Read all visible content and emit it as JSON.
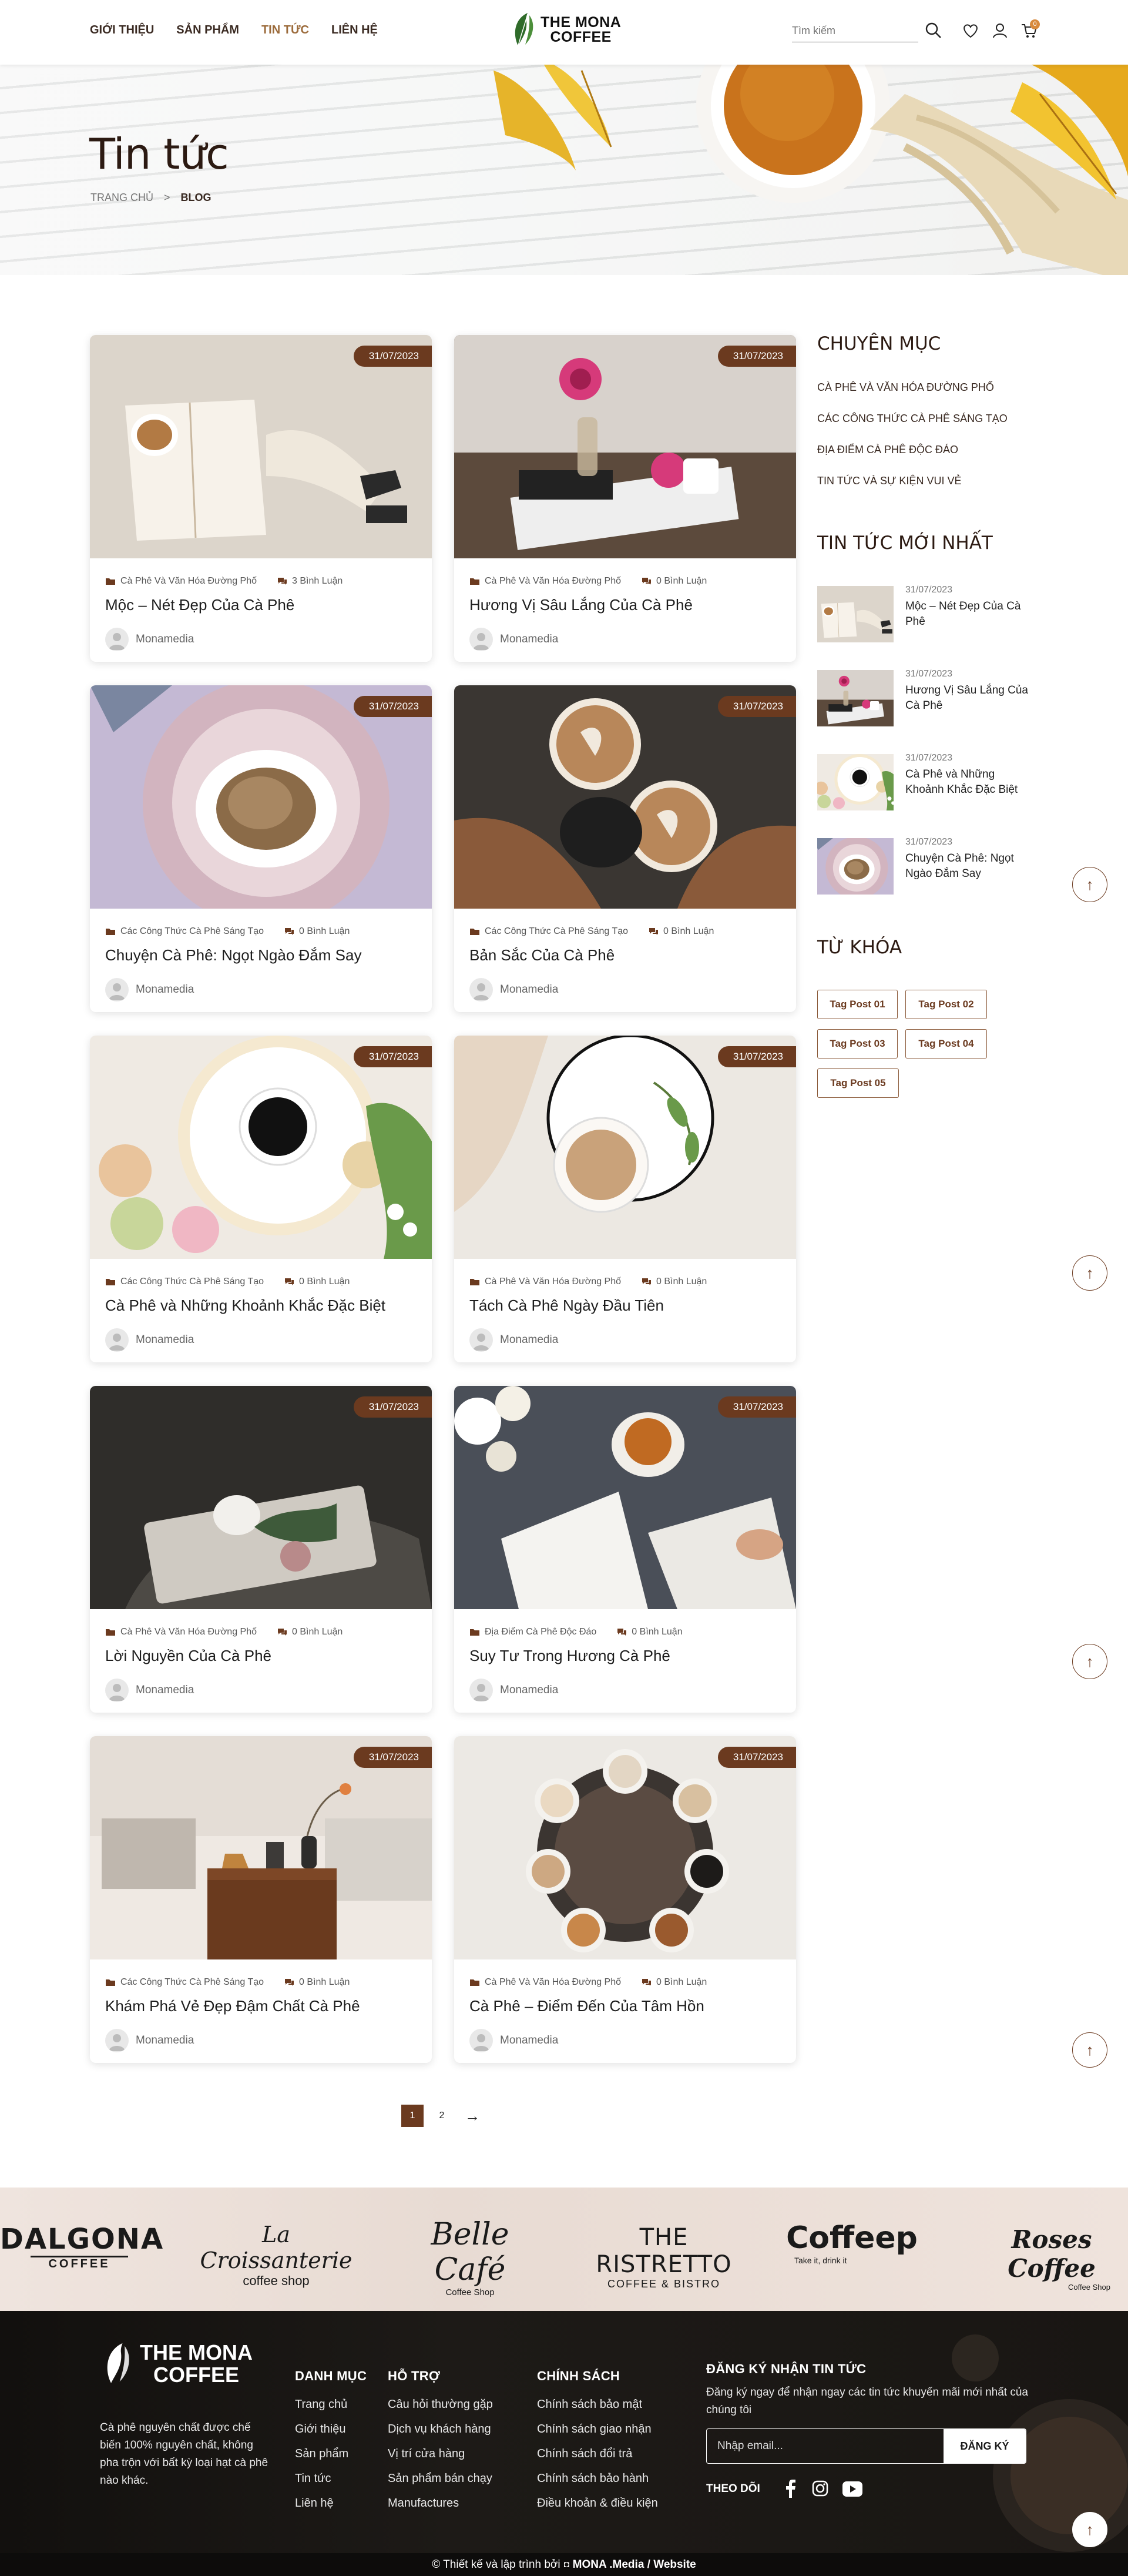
{
  "header": {
    "nav": [
      "GIỚI THIỆU",
      "SẢN PHẨM",
      "TIN TỨC",
      "LIÊN HỆ"
    ],
    "logo_line1": "THE MONA",
    "logo_line2": "COFFEE",
    "search_placeholder": "Tìm kiếm",
    "cart_count": "0"
  },
  "hero": {
    "title": "Tin tức",
    "breadcrumb_home": "TRANG CHỦ",
    "breadcrumb_sep": ">",
    "breadcrumb_current": "BLOG"
  },
  "posts": [
    {
      "date": "31/07/2023",
      "category": "Cà Phê Và Văn Hóa Đường Phố",
      "comments": "3 Bình Luận",
      "title": "Mộc – Nét Đẹp Của Cà Phê",
      "author": "Monamedia"
    },
    {
      "date": "31/07/2023",
      "category": "Cà Phê Và Văn Hóa Đường Phố",
      "comments": "0 Bình Luận",
      "title": "Hương Vị Sâu Lắng Của Cà Phê",
      "author": "Monamedia"
    },
    {
      "date": "31/07/2023",
      "category": "Các Công Thức Cà Phê Sáng Tạo",
      "comments": "0 Bình Luận",
      "title": "Chuyện Cà Phê: Ngọt Ngào Đắm Say",
      "author": "Monamedia"
    },
    {
      "date": "31/07/2023",
      "category": "Các Công Thức Cà Phê Sáng Tạo",
      "comments": "0 Bình Luận",
      "title": "Bản Sắc Của Cà Phê",
      "author": "Monamedia"
    },
    {
      "date": "31/07/2023",
      "category": "Các Công Thức Cà Phê Sáng Tạo",
      "comments": "0 Bình Luận",
      "title": "Cà Phê và Những Khoảnh Khắc Đặc Biệt",
      "author": "Monamedia"
    },
    {
      "date": "31/07/2023",
      "category": "Cà Phê Và Văn Hóa Đường Phố",
      "comments": "0 Bình Luận",
      "title": "Tách Cà Phê Ngày Đầu Tiên",
      "author": "Monamedia"
    },
    {
      "date": "31/07/2023",
      "category": "Cà Phê Và Văn Hóa Đường Phố",
      "comments": "0 Bình Luận",
      "title": "Lời Nguyền Của Cà Phê",
      "author": "Monamedia"
    },
    {
      "date": "31/07/2023",
      "category": "Địa Điểm Cà Phê Độc Đáo",
      "comments": "0 Bình Luận",
      "title": "Suy Tư Trong Hương Cà Phê",
      "author": "Monamedia"
    },
    {
      "date": "31/07/2023",
      "category": "Các Công Thức Cà Phê Sáng Tạo",
      "comments": "0 Bình Luận",
      "title": "Khám Phá Vẻ Đẹp Đậm Chất Cà Phê",
      "author": "Monamedia"
    },
    {
      "date": "31/07/2023",
      "category": "Cà Phê Và Văn Hóa Đường Phố",
      "comments": "0 Bình Luận",
      "title": "Cà Phê – Điểm Đến Của Tâm Hồn",
      "author": "Monamedia"
    }
  ],
  "sidebar": {
    "categories_title": "CHUYÊN MỤC",
    "categories": [
      "CÀ PHÊ VÀ VĂN HÓA ĐƯỜNG PHỐ",
      "CÁC CÔNG THỨC CÀ PHÊ SÁNG TẠO",
      "ĐỊA ĐIỂM CÀ PHÊ ĐỘC ĐÁO",
      "TIN TỨC VÀ SỰ KIỆN VUI VẺ"
    ],
    "recent_title": "TIN TỨC MỚI NHẤT",
    "recent": [
      {
        "date": "31/07/2023",
        "title": "Mộc – Nét Đẹp Của Cà Phê"
      },
      {
        "date": "31/07/2023",
        "title": "Hương Vị Sâu Lắng Của Cà Phê"
      },
      {
        "date": "31/07/2023",
        "title": "Cà Phê và Những Khoảnh Khắc Đặc Biệt"
      },
      {
        "date": "31/07/2023",
        "title": "Chuyện Cà Phê: Ngọt Ngào Đắm Say"
      }
    ],
    "tags_title": "TỪ KHÓA",
    "tags": [
      "Tag Post 01",
      "Tag Post 02",
      "Tag Post 03",
      "Tag Post 04",
      "Tag Post 05"
    ]
  },
  "pagination": {
    "pages": [
      "1",
      "2"
    ],
    "next": "→",
    "current": "1"
  },
  "brands": [
    {
      "name": "DALGONA",
      "sub": "COFFEE"
    },
    {
      "name": "La Croissanterie",
      "sub": "coffee shop"
    },
    {
      "name": "Belle Café",
      "sub": "Coffee Shop"
    },
    {
      "name": "THE RISTRETTO",
      "sub": "COFFEE & BISTRO"
    },
    {
      "name": "Coffeep",
      "sub": "Take it, drink it"
    },
    {
      "name": "Roses Coffee",
      "sub": "Coffee Shop"
    }
  ],
  "footer": {
    "logo_line1": "THE MONA",
    "logo_line2": "COFFEE",
    "description": "Cà phê nguyên chất được chế biến 100% nguyên chất, không pha trộn với bất kỳ loại hạt cà phê nào khác.",
    "col1_title": "DANH MỤC",
    "col1": [
      "Trang chủ",
      "Giới thiệu",
      "Sản phẩm",
      "Tin tức",
      "Liên hệ"
    ],
    "col2_title": "HỖ TRỢ",
    "col2": [
      "Câu hỏi thường gặp",
      "Dịch vụ khách hàng",
      "Vị trí cửa hàng",
      "Sản phẩm bán chạy",
      "Manufactures"
    ],
    "col3_title": "CHÍNH SÁCH",
    "col3": [
      "Chính sách bảo mật",
      "Chính sách giao nhận",
      "Chính sách đổi trả",
      "Chính sách bảo hành",
      "Điều khoản & điều kiện"
    ],
    "news_title": "ĐĂNG KÝ NHẬN TIN TỨC",
    "news_desc": "Đăng ký ngay để nhận ngay các tin tức khuyến mãi mới nhất của chúng tôi",
    "email_placeholder": "Nhập email...",
    "subscribe_label": "ĐĂNG KÝ",
    "follow_label": "THEO DÕI",
    "bottom_text": "© Thiết kế và lập trình bởi",
    "bottom_brand": "MONA .Media / Website"
  },
  "colors": {
    "brand_brown": "#6b3a1f",
    "accent": "#9b6a3a",
    "badge": "#d88a3d",
    "footer_bg": "#1a1714"
  }
}
